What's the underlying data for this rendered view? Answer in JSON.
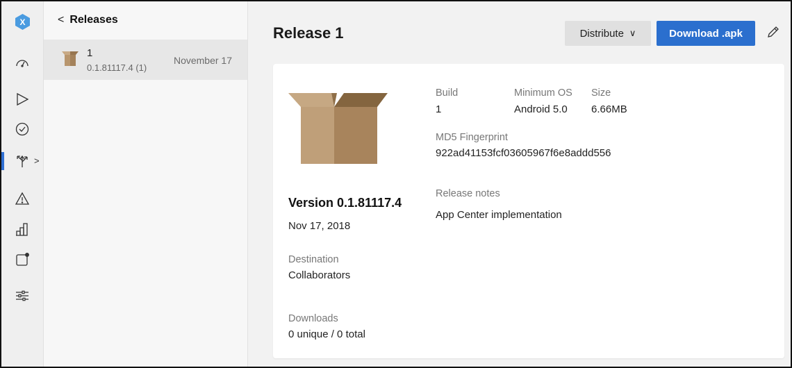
{
  "rail": {
    "logo_letter": "X",
    "icons": [
      "dashboard-icon",
      "build-icon",
      "test-icon",
      "distribute-icon",
      "diagnostics-icon",
      "analytics-icon",
      "push-icon",
      "settings-icon"
    ],
    "active_chevron": ">"
  },
  "list": {
    "back_label": "Releases",
    "back_chevron": "<",
    "releases": [
      {
        "number": "1",
        "version": "0.1.81117.4 (1)",
        "date": "November 17"
      }
    ]
  },
  "main": {
    "title": "Release 1",
    "distribute_label": "Distribute",
    "distribute_chevron": "∨",
    "download_label": "Download .apk"
  },
  "details": {
    "version": "Version 0.1.81117.4",
    "date": "Nov 17, 2018",
    "destination_label": "Destination",
    "destination_value": "Collaborators",
    "downloads_label": "Downloads",
    "downloads_value": "0 unique / 0 total",
    "build_label": "Build",
    "build_value": "1",
    "min_os_label": "Minimum OS",
    "min_os_value": "Android 5.0",
    "size_label": "Size",
    "size_value": "6.66MB",
    "md5_label": "MD5 Fingerprint",
    "md5_value": "922ad41153fcf03605967f6e8addd556",
    "notes_label": "Release notes",
    "notes_value": "App Center implementation"
  },
  "colors": {
    "accent": "#2b6fce",
    "box_light": "#bf9f79",
    "box_dark": "#a8845c"
  }
}
